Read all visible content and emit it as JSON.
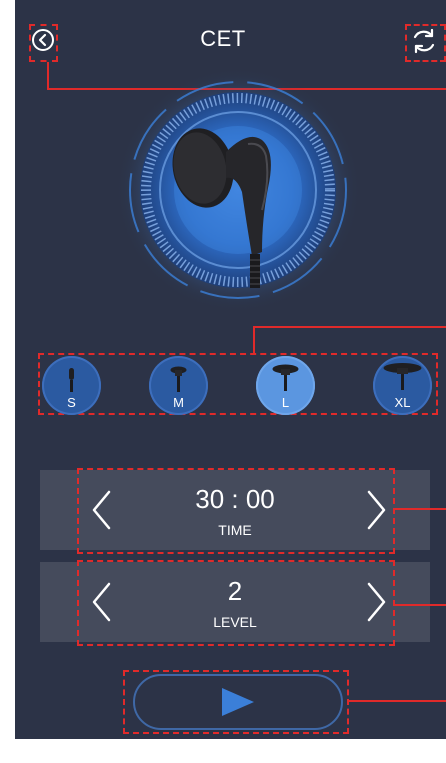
{
  "header": {
    "title": "CET",
    "back_icon": "back-arrow-circle-icon",
    "refresh_icon": "refresh-icon"
  },
  "device": {
    "image": "handpiece-image",
    "dial": "circular-dial-graphic"
  },
  "sizes": [
    {
      "label": "S",
      "selected": false
    },
    {
      "label": "M",
      "selected": false
    },
    {
      "label": "L",
      "selected": true
    },
    {
      "label": "XL",
      "selected": false
    }
  ],
  "time_control": {
    "value": "30 : 00",
    "label": "TIME"
  },
  "level_control": {
    "value": "2",
    "label": "LEVEL"
  },
  "play_button": {
    "icon": "play-icon"
  },
  "colors": {
    "background": "#2c3347",
    "panel": "#454b5c",
    "accent": "#3b7fd8",
    "selected_size": "#5b96e0",
    "annotation": "#e02a2a"
  }
}
